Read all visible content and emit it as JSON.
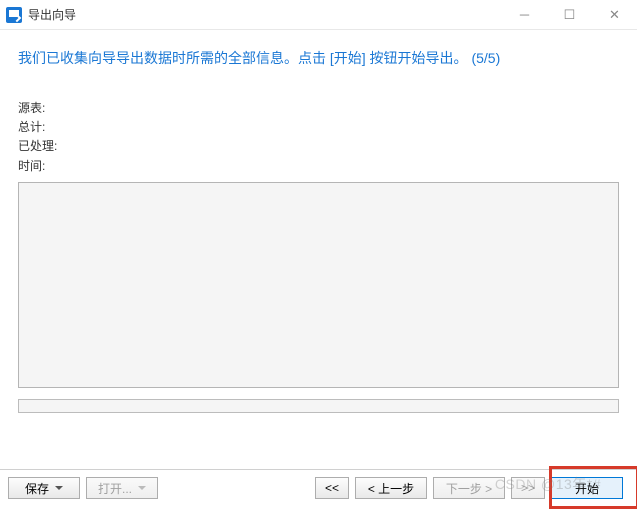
{
  "titlebar": {
    "title": "导出向导"
  },
  "header": {
    "message": "我们已收集向导导出数据时所需的全部信息。点击 [开始] 按钮开始导出。",
    "step": "(5/5)"
  },
  "info": {
    "source_label": "源表:",
    "source_value": "",
    "total_label": "总计:",
    "total_value": "",
    "processed_label": "已处理:",
    "processed_value": "",
    "time_label": "时间:",
    "time_value": ""
  },
  "log": {
    "content": ""
  },
  "footer": {
    "save_label": "保存",
    "open_label": "打开...",
    "first_label": "<<",
    "prev_label": "< 上一步",
    "next_label": "下一步 >",
    "last_label": ">>",
    "start_label": "开始"
  },
  "watermark": "CSDN @13年*#"
}
